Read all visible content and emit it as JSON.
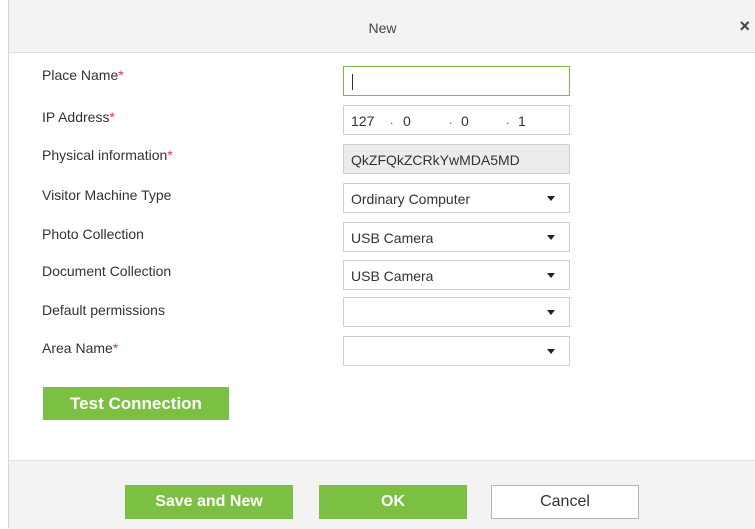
{
  "dialog": {
    "title": "New",
    "close_glyph": "×"
  },
  "form": {
    "required_mark": "*",
    "place_name": {
      "label": "Place Name",
      "required": true,
      "value": ""
    },
    "ip_address": {
      "label": "IP Address",
      "required": true,
      "segments": [
        "127",
        "0",
        "0",
        "1"
      ],
      "separator": "."
    },
    "physical_information": {
      "label": "Physical information",
      "required": true,
      "value": "QkZFQkZCRkYwMDA5MD"
    },
    "visitor_machine_type": {
      "label": "Visitor Machine Type",
      "required": false,
      "value": "Ordinary Computer"
    },
    "photo_collection": {
      "label": "Photo Collection",
      "required": false,
      "value": "USB Camera"
    },
    "document_collection": {
      "label": "Document Collection",
      "required": false,
      "value": "USB Camera"
    },
    "default_permissions": {
      "label": "Default permissions",
      "required": false,
      "value": ""
    },
    "area_name": {
      "label": "Area Name",
      "required": true,
      "value": ""
    },
    "test_connection_label": "Test Connection"
  },
  "footer": {
    "save_and_new_label": "Save and New",
    "ok_label": "OK",
    "cancel_label": "Cancel"
  },
  "colors": {
    "accent": "#7cc043",
    "required": "#e53935",
    "focus_border": "#7dbb4a"
  }
}
